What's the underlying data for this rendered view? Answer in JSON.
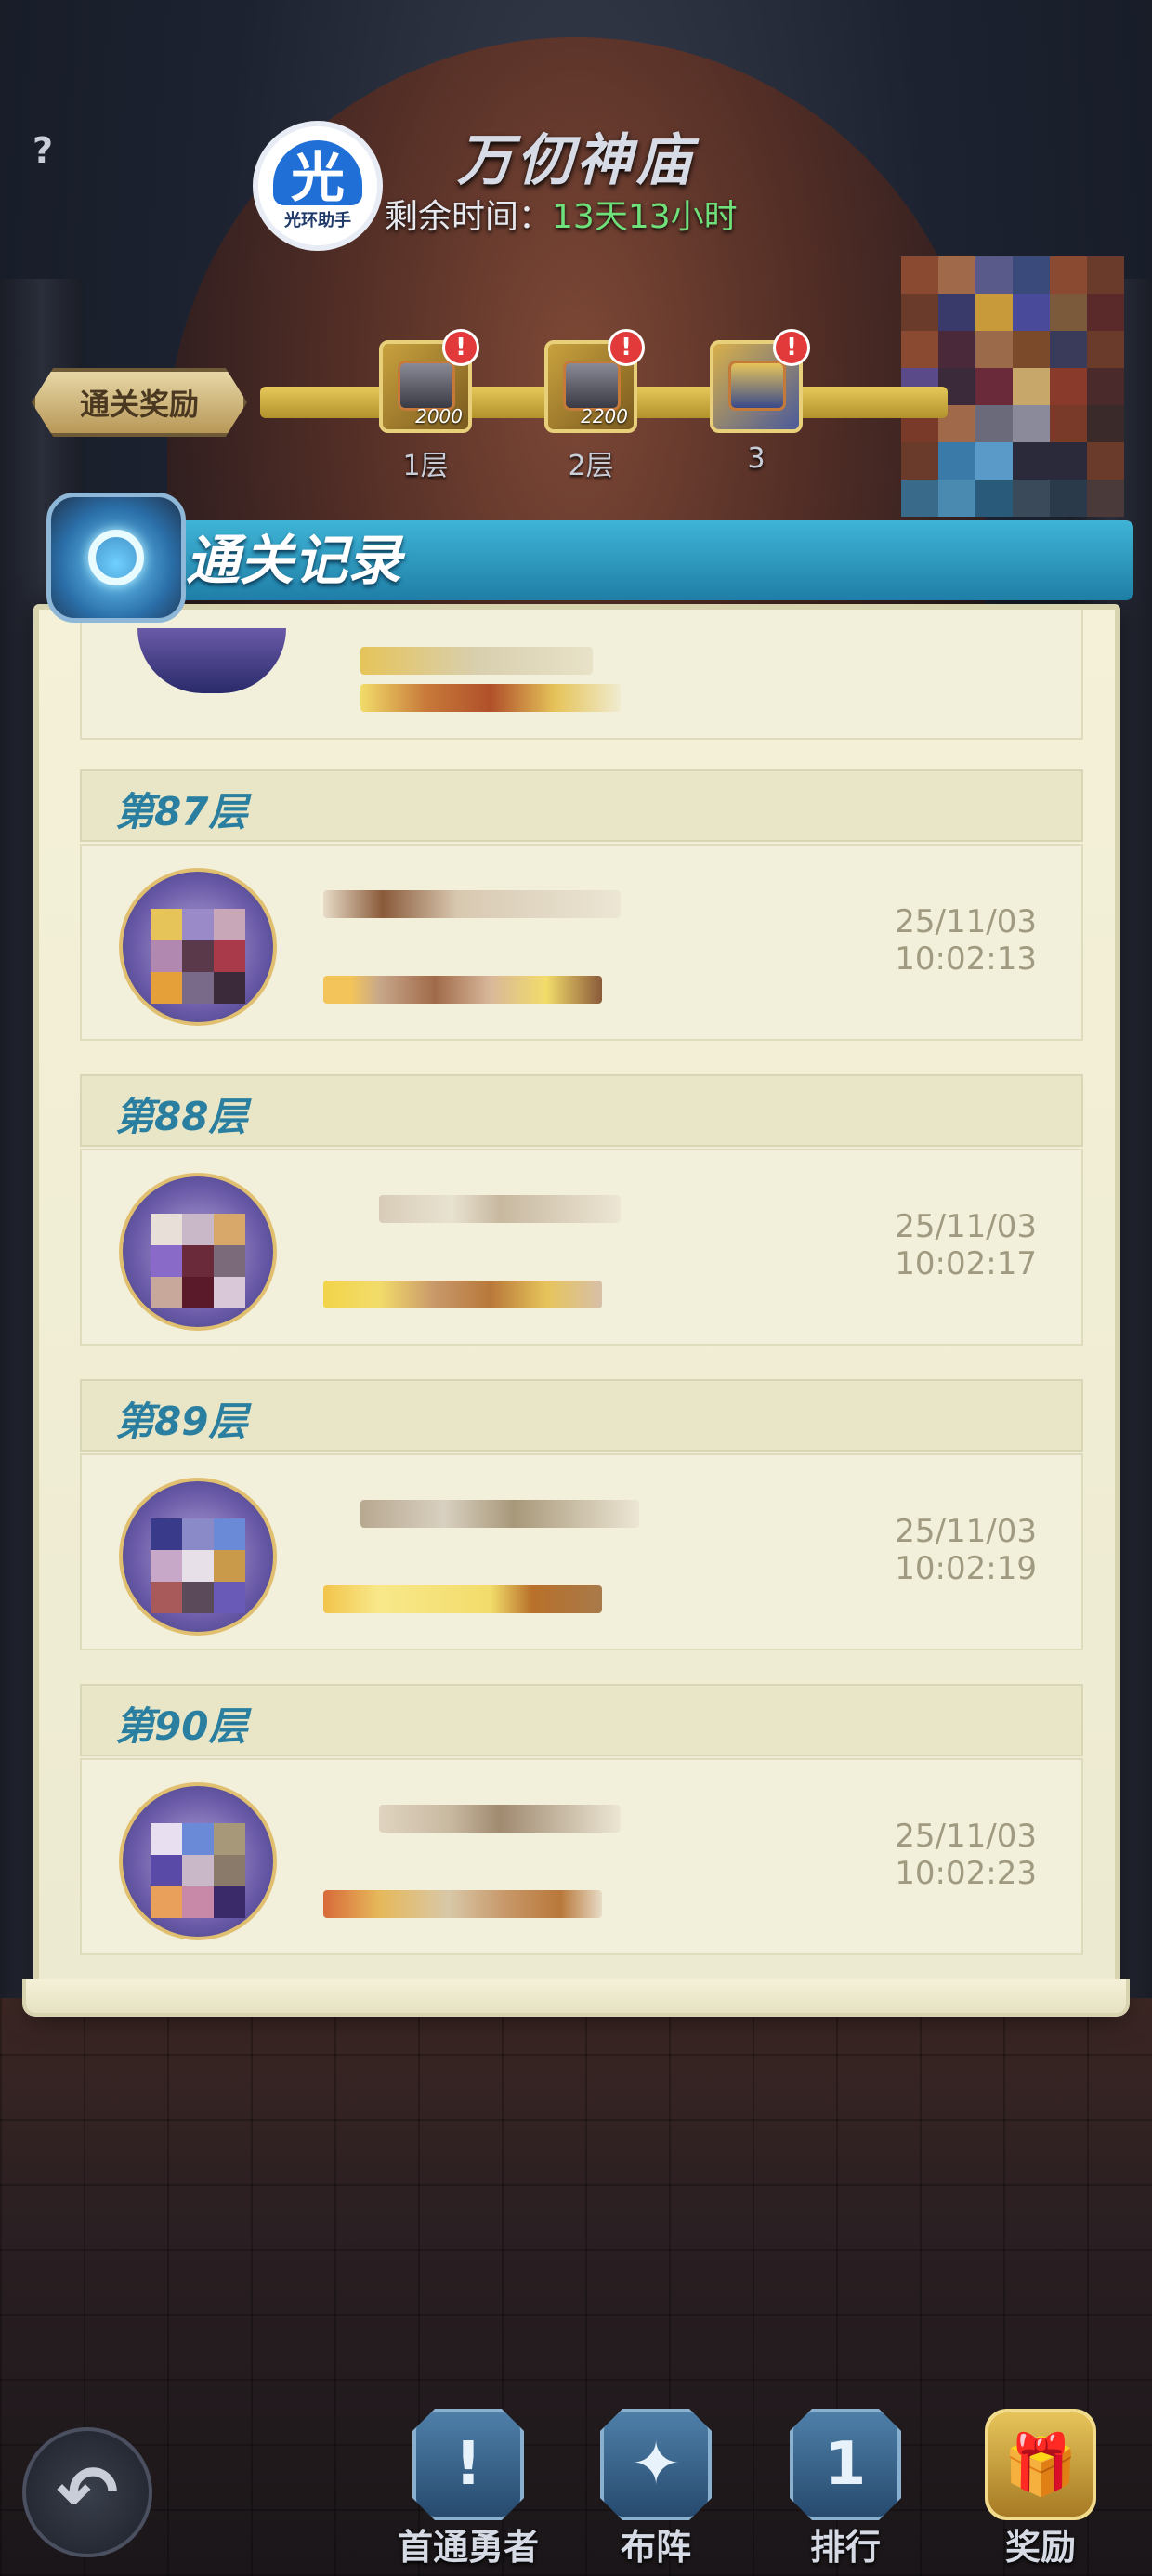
{
  "header": {
    "help_label": "?",
    "logo_glyph": "光",
    "logo_sub": "光环助手",
    "title": "万仞神庙",
    "timer_label": "剩余时间：",
    "timer_value": "13天13小时"
  },
  "rewards": {
    "label": "通关奖励",
    "items": [
      {
        "amount": "2000",
        "floor": "1层",
        "alert": "!"
      },
      {
        "amount": "2200",
        "floor": "2层",
        "alert": "!"
      },
      {
        "amount": "",
        "floor": "3",
        "alert": "!"
      }
    ]
  },
  "records": {
    "title": "通关记录",
    "entries": [
      {
        "floor": "第87层",
        "date": "25/11/03",
        "time": "10:02:13"
      },
      {
        "floor": "第88层",
        "date": "25/11/03",
        "time": "10:02:17"
      },
      {
        "floor": "第89层",
        "date": "25/11/03",
        "time": "10:02:19"
      },
      {
        "floor": "第90层",
        "date": "25/11/03",
        "time": "10:02:23"
      }
    ]
  },
  "nav": {
    "items": [
      {
        "label": "首通勇者",
        "icon": "exclamation-shield-icon",
        "glyph": "!"
      },
      {
        "label": "布阵",
        "icon": "shield-star-icon",
        "glyph": "✦"
      },
      {
        "label": "排行",
        "icon": "rank-badge-icon",
        "glyph": "1"
      },
      {
        "label": "奖励",
        "icon": "gift-box-icon",
        "glyph": "🎁"
      }
    ]
  },
  "colors": {
    "accent_blue": "#2a7ea0",
    "timer_green": "#6fe07a",
    "parchment": "#f2f0da"
  }
}
